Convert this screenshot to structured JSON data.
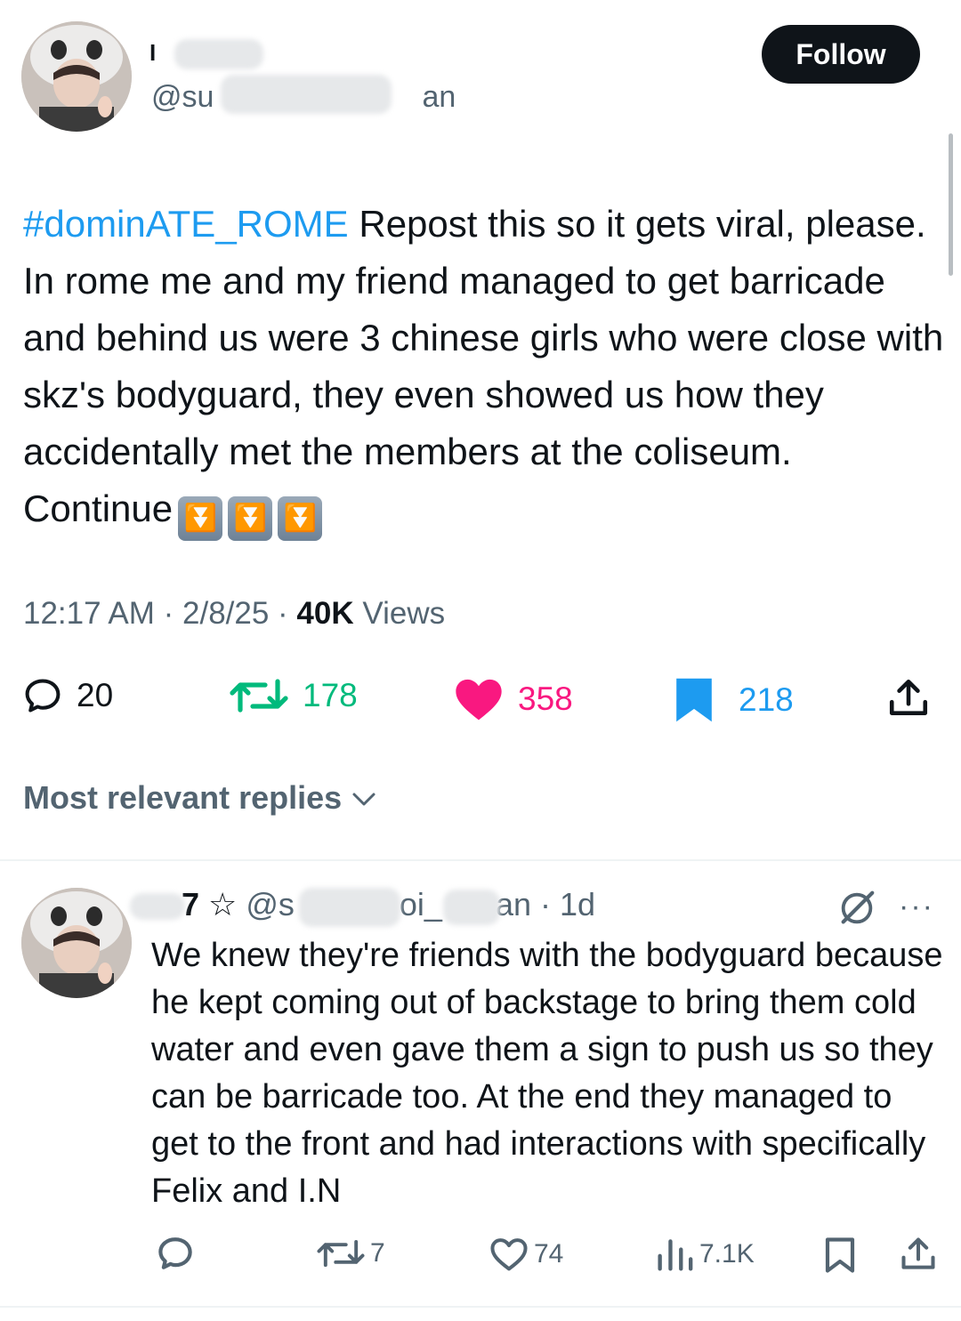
{
  "tweet": {
    "author_name": "I",
    "author_handle_start": "@su",
    "author_handle_end": "an",
    "follow_label": "Follow",
    "hashtag": "#dominATE_ROME",
    "text": " Repost this so it gets viral, please. In rome me and my friend managed to get barricade and behind us were 3 chinese girls who were close with skz's bodyguard, they even showed us how they accidentally met the members at the coliseum. Continue",
    "emoji": [
      "⏬",
      "⏬",
      "⏬"
    ],
    "time": "12:17 AM",
    "date": "2/8/25",
    "views_count": "40K",
    "views_label": "Views",
    "replies": "20",
    "reposts": "178",
    "likes": "358",
    "bookmarks": "218",
    "colors": {
      "link": "#1d9bf0",
      "repost": "#00ba7c",
      "like": "#f91880",
      "bookmark": "#1d9bf0"
    }
  },
  "replies_header": {
    "label": "Most relevant replies"
  },
  "reply": {
    "name_tail": "7",
    "star": "☆",
    "handle_start": "@s",
    "handle_mid": "oi_",
    "handle_end": "an",
    "time": "· 1d",
    "text": "We knew they're friends with the bodyguard because he kept coming out of backstage to bring them cold water and even gave them a sign to push us so they can be barricade too. At the end they managed to get to the front and had interactions with specifically Felix and I.N",
    "reposts": "7",
    "likes": "74",
    "views": "7.1K"
  }
}
